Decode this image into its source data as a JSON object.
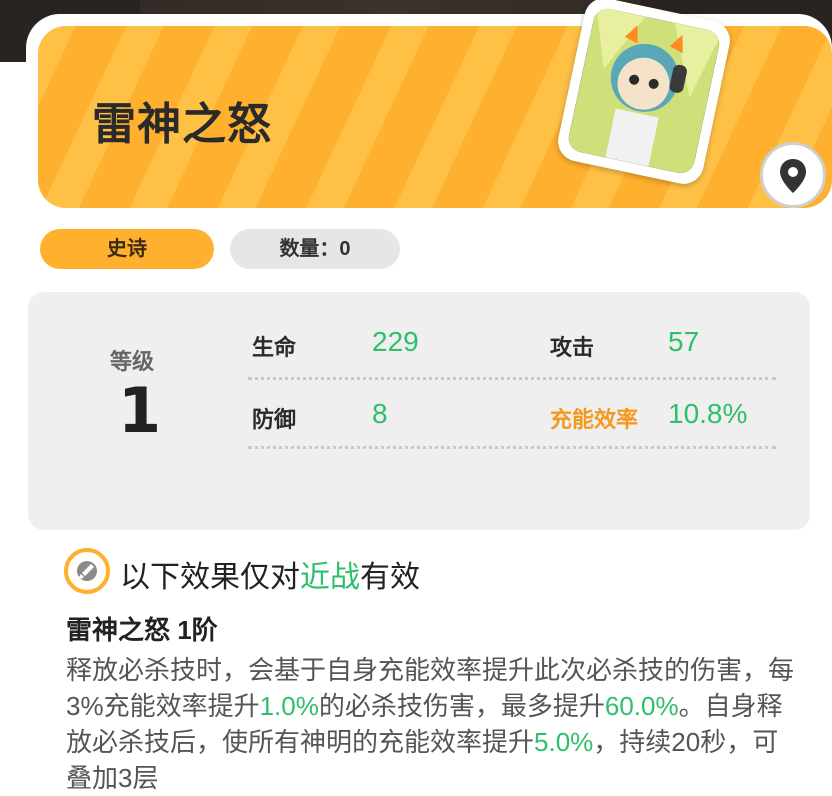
{
  "header": {
    "title": "雷神之怒",
    "portrait_icon": "character-portrait-icon",
    "location_icon": "map-pin-icon"
  },
  "tags": {
    "rarity": "史诗",
    "quantity": "数量：0"
  },
  "stats": {
    "level_label": "等级",
    "level_value": "1",
    "items": [
      {
        "name": "生命",
        "value": "229"
      },
      {
        "name": "攻击",
        "value": "57"
      },
      {
        "name": "防御",
        "value": "8"
      },
      {
        "name": "充能效率",
        "value": "10.8%"
      }
    ]
  },
  "effect": {
    "icon": "sword-icon",
    "prefix": "以下效果仅对",
    "highlight": "近战",
    "suffix": "有效"
  },
  "skill": {
    "title": "雷神之怒 1阶",
    "desc_1": "释放必杀技时，会基于自身充能效率提升此次必杀技的伤害，每3%充能效率提升",
    "desc_2": "1.0%",
    "desc_3": "的必杀技伤害，最多提升",
    "desc_4": "60.0%",
    "desc_5": "。自身释放必杀技后，使所有神明的充能效率提升",
    "desc_6": "5.0%",
    "desc_7": "，持续20秒，可叠加3层"
  },
  "colors": {
    "accent": "#ffb02e",
    "value_green": "#2fbf6a",
    "highlight_orange": "#f39a1e"
  }
}
